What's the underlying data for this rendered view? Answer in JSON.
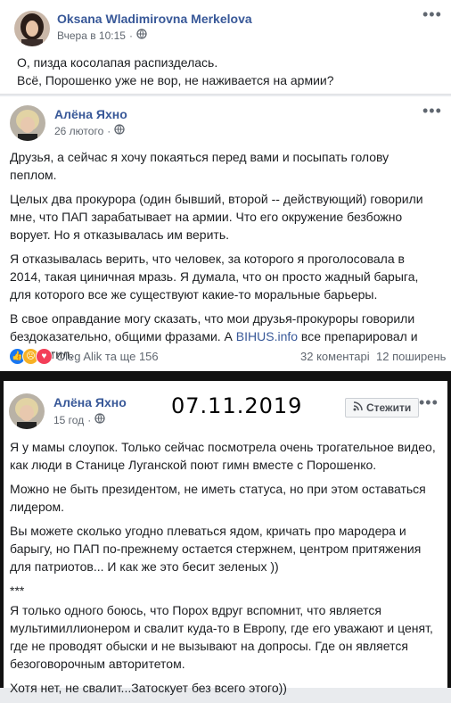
{
  "post1": {
    "author": "Oksana Wladimirovna Merkelova",
    "time": "Вчера в 10:15",
    "lines": [
      "О, пизда косолапая распизделась.",
      "Всё, Порошенко уже не вор, не наживается на армии?"
    ]
  },
  "post2": {
    "author": "Алёна Яхно",
    "time": "26 лютого",
    "paragraphs": [
      "Друзья, а сейчас я хочу покаяться перед вами и посыпать голову пеплом.",
      "Целых два прокурора (один бывший, второй -- действующий) говорили мне, что ПАП зарабатывает на армии. Что его окружение безбожно ворует. Но я отказывалась им верить.",
      "Я отказывалась верить, что человек, за которого я проголосовала в 2014, такая циничная мразь. Я думала, что он просто жадный барыга, для которого все же существуют какие-то моральные барьеры."
    ],
    "last_para_before": "В свое оправдание могу сказать, что мои друзья-прокуроры говорили бездоказательно, общими фразами. А ",
    "last_para_link": "BIHUS.info",
    "last_para_after": " все препарировал и подсветил.",
    "reactions_text": "Oleg Alik та ще 156",
    "comments": "32 коментарі",
    "shares": "12 поширень"
  },
  "post3": {
    "author": "Алёна Яхно",
    "time": "15 год",
    "date_overlay": "07.11.2019",
    "follow_label": "Стежити",
    "paragraphs": [
      "Я у мамы слоупок. Только сейчас посмотрела очень трогательное видео, как люди в Станице Луганской поют гимн вместе с Порошенко.",
      "Можно не быть президентом, не иметь статуса, но при этом оставаться лидером.",
      "Вы можете сколько угодно плеваться ядом, кричать про мародера и барыгу, но ПАП по-прежнему остается стержнем, центром притяжения для патриотов... И как же это бесит зеленых ))",
      "***",
      "Я только одного боюсь, что Порох вдруг вспомнит, что является мультимиллионером и свалит куда-то в Европу, где его уважают и ценят, где не проводят обыски и не вызывают на допросы. Где он является безоговорочным авторитетом.",
      "Хотя нет, не свалит...Затоскует без всего этого))"
    ]
  },
  "colors": {
    "link": "#385898",
    "meta": "#606770",
    "text": "#1c1e21"
  }
}
